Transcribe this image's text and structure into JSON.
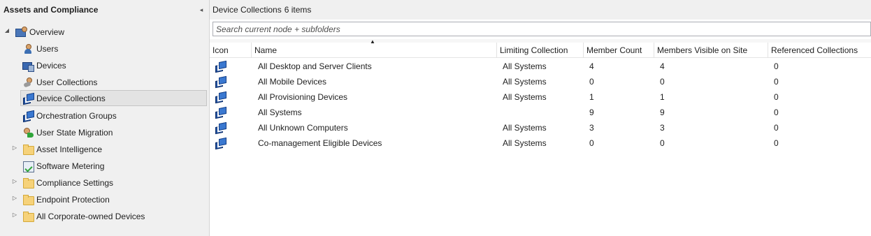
{
  "nav": {
    "title": "Assets and Compliance",
    "collapse_glyph": "◂",
    "items": [
      {
        "label": "Overview",
        "icon": "overview-icon",
        "expander": "◢"
      },
      {
        "label": "Users",
        "icon": "user-icon"
      },
      {
        "label": "Devices",
        "icon": "devices-icon"
      },
      {
        "label": "User Collections",
        "icon": "user-collection-icon"
      },
      {
        "label": "Device Collections",
        "icon": "device-collection-icon",
        "selected": true
      },
      {
        "label": "Orchestration Groups",
        "icon": "orchestration-group-icon"
      },
      {
        "label": "User State Migration",
        "icon": "migration-icon"
      },
      {
        "label": "Asset Intelligence",
        "icon": "folder-icon",
        "expander": "▷"
      },
      {
        "label": "Software Metering",
        "icon": "software-metering-icon"
      },
      {
        "label": "Compliance Settings",
        "icon": "folder-icon",
        "expander": "▷"
      },
      {
        "label": "Endpoint Protection",
        "icon": "folder-icon",
        "expander": "▷"
      },
      {
        "label": "All Corporate-owned Devices",
        "icon": "folder-icon",
        "expander": "▷"
      }
    ]
  },
  "content": {
    "title": "Device Collections",
    "count": "6 items",
    "search_placeholder": "Search current node + subfolders",
    "sort_glyph": "▲",
    "columns": [
      "Icon",
      "Name",
      "Limiting Collection",
      "Member Count",
      "Members Visible on Site",
      "Referenced Collections"
    ],
    "rows": [
      {
        "icon": "device-collection-icon",
        "name": "All Desktop and Server Clients",
        "limiting": "All Systems",
        "member_count": "4",
        "visible": "4",
        "referenced": "0"
      },
      {
        "icon": "device-collection-icon",
        "name": "All Mobile Devices",
        "limiting": "All Systems",
        "member_count": "0",
        "visible": "0",
        "referenced": "0"
      },
      {
        "icon": "device-collection-icon",
        "name": "All Provisioning Devices",
        "limiting": "All Systems",
        "member_count": "1",
        "visible": "1",
        "referenced": "0"
      },
      {
        "icon": "device-collection-icon",
        "name": "All Systems",
        "limiting": "",
        "member_count": "9",
        "visible": "9",
        "referenced": "0"
      },
      {
        "icon": "device-collection-icon",
        "name": "All Unknown Computers",
        "limiting": "All Systems",
        "member_count": "3",
        "visible": "3",
        "referenced": "0"
      },
      {
        "icon": "device-collection-icon",
        "name": "Co-management Eligible Devices",
        "limiting": "All Systems",
        "member_count": "0",
        "visible": "0",
        "referenced": "0"
      }
    ]
  }
}
